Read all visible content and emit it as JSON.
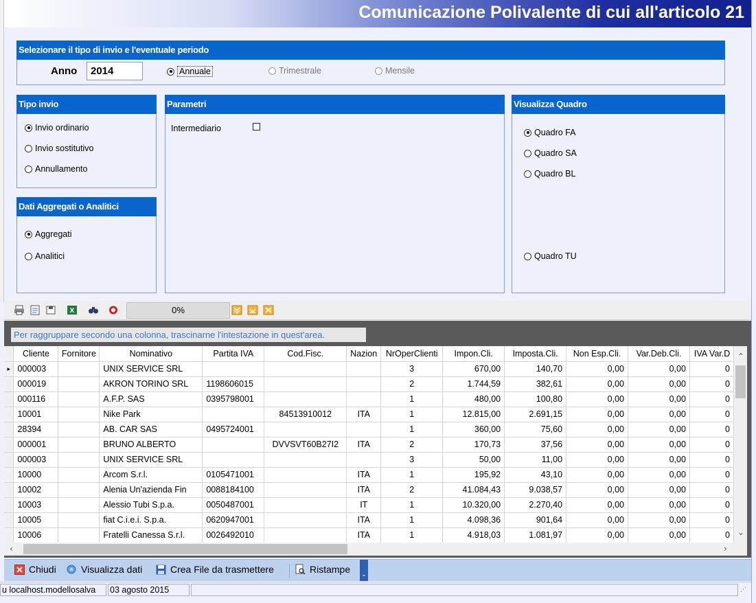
{
  "window": {
    "title": "Comunicazione Polivalente di cui all'articolo 21"
  },
  "periodo": {
    "header": "Selezionare il tipo di invio e l'eventuale periodo",
    "anno_label": "Anno",
    "anno_value": "2014",
    "options": [
      {
        "label": "Annuale",
        "selected": true,
        "enabled": true
      },
      {
        "label": "Trimestrale",
        "selected": false,
        "enabled": false
      },
      {
        "label": "Mensile",
        "selected": false,
        "enabled": false
      }
    ]
  },
  "tipo_invio": {
    "header": "Tipo invio",
    "options": [
      {
        "label": "Invio ordinario",
        "selected": true
      },
      {
        "label": "Invio sostitutivo",
        "selected": false
      },
      {
        "label": "Annullamento",
        "selected": false
      }
    ]
  },
  "dati": {
    "header": "Dati Aggregati o Analitici",
    "options": [
      {
        "label": "Aggregati",
        "selected": true
      },
      {
        "label": "Analitici",
        "selected": false
      }
    ]
  },
  "parametri": {
    "header": "Parametri",
    "intermediario_label": "Intermediario",
    "intermediario_checked": false
  },
  "quadro": {
    "header": "Visualizza Quadro",
    "options": [
      {
        "label": "Quadro FA",
        "selected": true
      },
      {
        "label": "Quadro SA",
        "selected": false
      },
      {
        "label": "Quadro BL",
        "selected": false
      },
      {
        "label": "Quadro TU",
        "selected": false
      }
    ]
  },
  "toolbar": {
    "progress": "0%",
    "icons": [
      "print-icon",
      "preview-icon",
      "export-icon",
      "excel-icon",
      "find-icon",
      "refresh-icon",
      "expand-icon",
      "collapse-icon",
      "clear-icon"
    ]
  },
  "grid": {
    "group_hint": "Per raggruppare secondo una colonna, trascinarne l'intestazione in quest'area.",
    "columns": [
      "Cliente",
      "Fornitore",
      "Nominativo",
      "Partita IVA",
      "Cod.Fisc.",
      "Nazion",
      "NrOperClienti",
      "Impon.Cli.",
      "Imposta.Cli.",
      "Non Esp.Cli.",
      "Var.Deb.Cli.",
      "IVA Var.D"
    ],
    "rows": [
      [
        "000003",
        "",
        "UNIX SERVICE SRL",
        "",
        "",
        "",
        "3",
        "670,00",
        "140,70",
        "0,00",
        "0,00",
        "0"
      ],
      [
        "000019",
        "",
        "AKRON TORINO SRL",
        "1198606015",
        "",
        "",
        "2",
        "1.744,59",
        "382,61",
        "0,00",
        "0,00",
        "0"
      ],
      [
        "000116",
        "",
        "A.F.P. SAS",
        "0395798001",
        "",
        "",
        "1",
        "480,00",
        "100,80",
        "0,00",
        "0,00",
        "0"
      ],
      [
        "10001",
        "",
        "Nike Park",
        "",
        "84513910012",
        "ITA",
        "1",
        "12.815,00",
        "2.691,15",
        "0,00",
        "0,00",
        "0"
      ],
      [
        "28394",
        "",
        "AB. CAR SAS",
        "0495724001",
        "",
        "",
        "1",
        "360,00",
        "75,60",
        "0,00",
        "0,00",
        "0"
      ],
      [
        "000001",
        "",
        "BRUNO ALBERTO",
        "",
        "DVVSVT60B27I2",
        "ITA",
        "2",
        "170,73",
        "37,56",
        "0,00",
        "0,00",
        "0"
      ],
      [
        "000003",
        "",
        "UNIX SERVICE SRL",
        "",
        "",
        "",
        "3",
        "50,00",
        "11,00",
        "0,00",
        "0,00",
        "0"
      ],
      [
        "10000",
        "",
        "Arcom S.r.l.",
        "0105471001",
        "",
        "ITA",
        "1",
        "195,92",
        "43,10",
        "0,00",
        "0,00",
        "0"
      ],
      [
        "10002",
        "",
        "Alenia Un'azienda Fin",
        "0088184100",
        "",
        "ITA",
        "2",
        "41.084,43",
        "9.038,57",
        "0,00",
        "0,00",
        "0"
      ],
      [
        "10003",
        "",
        "Alessio Tubi S.p.a.",
        "0050487001",
        "",
        "IT",
        "1",
        "10.320,00",
        "2.270,40",
        "0,00",
        "0,00",
        "0"
      ],
      [
        "10005",
        "",
        "fiat C.i.e.i. S.p.a.",
        "0620947001",
        "",
        "ITA",
        "1",
        "4.098,36",
        "901,64",
        "0,00",
        "0,00",
        "0"
      ],
      [
        "10006",
        "",
        "Fratelli Canessa S.r.l.",
        "0026492010",
        "",
        "ITA",
        "1",
        "4.918,03",
        "1.081,97",
        "0,00",
        "0,00",
        "0"
      ]
    ]
  },
  "actions": {
    "chiudi": "Chiudi",
    "visualizza": "Visualizza dati",
    "crea": "Crea File da trasmettere",
    "ristampe": "Ristampe"
  },
  "status": {
    "connection": "u localhost.modellosalva",
    "date": "03 agosto 2015"
  }
}
